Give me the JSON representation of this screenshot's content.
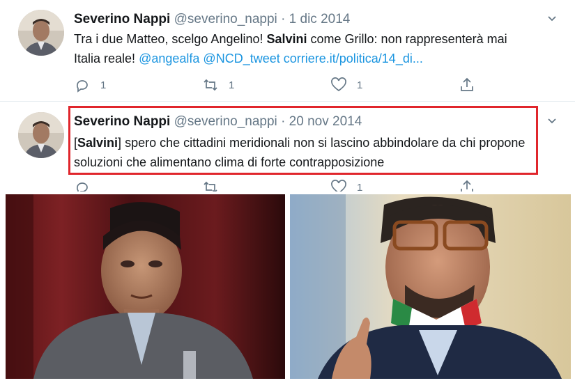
{
  "tweets": [
    {
      "author_name": "Severino Nappi",
      "handle": "@severino_nappi",
      "separator": "·",
      "date": "1 dic 2014",
      "text_part1": "Tra i due Matteo, scelgo Angelino! ",
      "text_bold": "Salvini",
      "text_part2": " come Grillo: non rappresenterà mai Italia reale! ",
      "mention1": "@angealfa",
      "mention2": "@NCD_tweet",
      "url": "corriere.it/politica/14_di...",
      "reply_count": "1",
      "retweet_count": "1",
      "like_count": "1"
    },
    {
      "author_name": "Severino Nappi",
      "handle": "@severino_nappi",
      "separator": "·",
      "date": "20 nov 2014",
      "bracket_open": "[",
      "text_bold": "Salvini",
      "bracket_close": "]",
      "text_rest": " spero che cittadini meridionali non si lascino abbindolare da chi propone soluzioni che alimentano clima di forte contrapposizione",
      "reply_count": "",
      "retweet_count": "",
      "like_count": "1"
    }
  ],
  "icons": {
    "reply": "reply-icon",
    "retweet": "retweet-icon",
    "like": "heart-icon",
    "share": "share-icon",
    "more": "chevron-down-icon"
  },
  "colors": {
    "link": "#1b95e0",
    "muted": "#657786",
    "highlight": "#e0262c"
  }
}
